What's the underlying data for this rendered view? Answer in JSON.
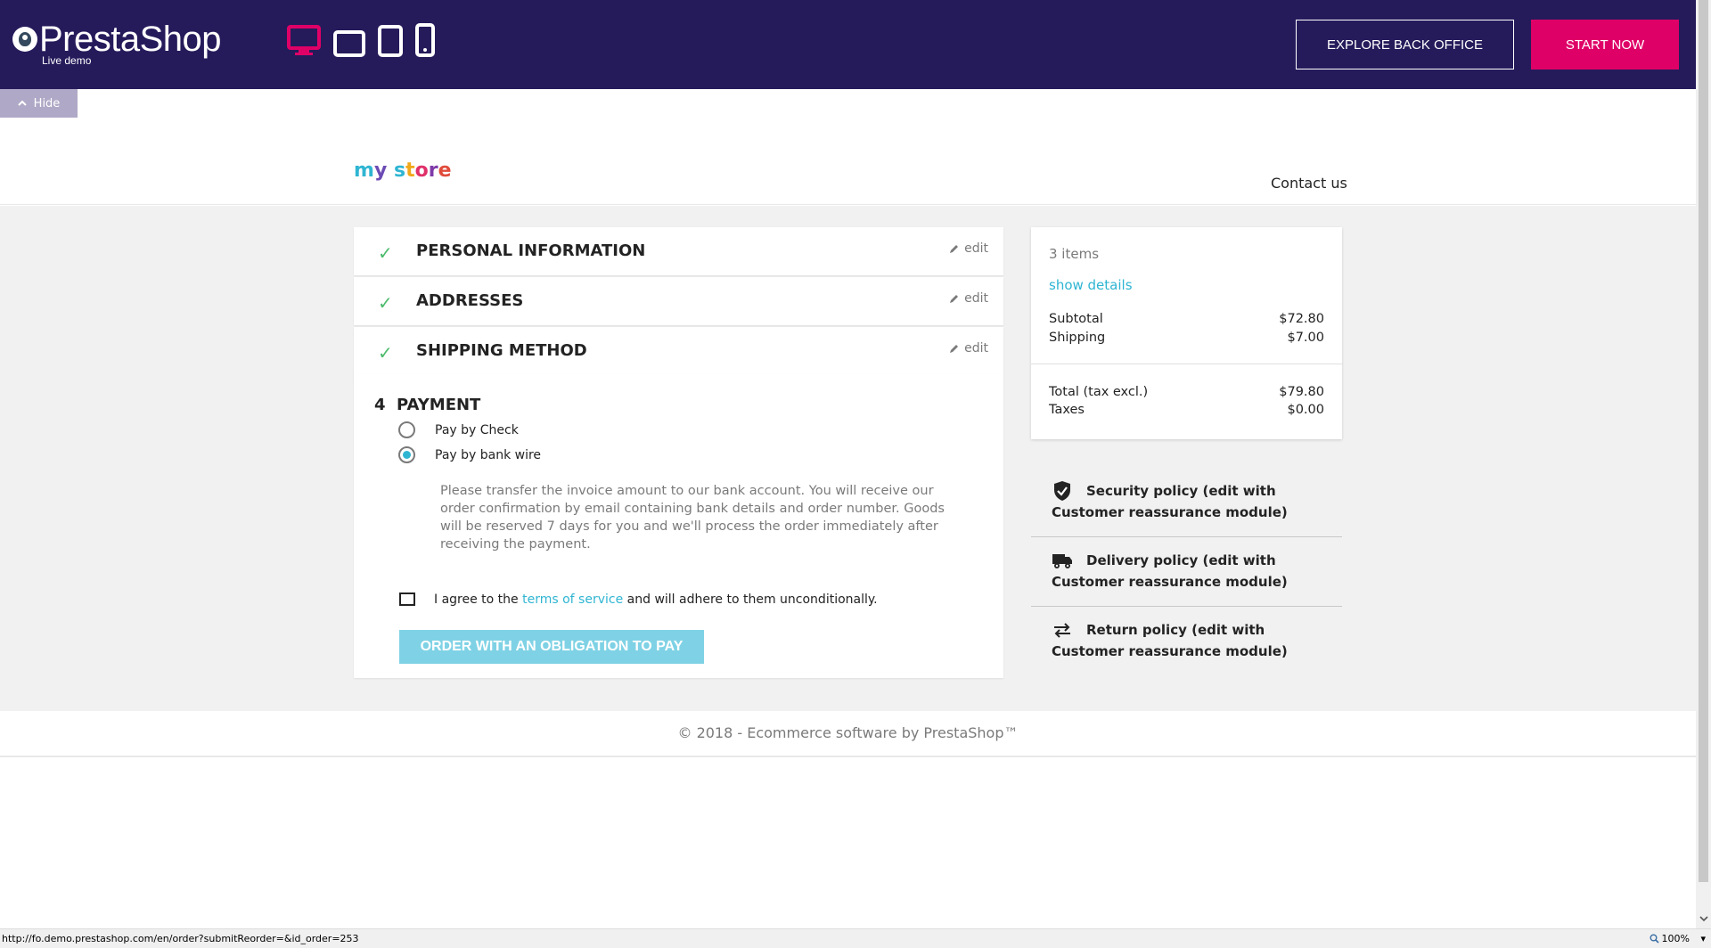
{
  "demo_bar": {
    "logo_text": "PrestaShop",
    "logo_sub": "Live demo",
    "devices": [
      "desktop-icon",
      "tablet-landscape-icon",
      "tablet-portrait-icon",
      "mobile-icon"
    ],
    "explore_label": "EXPLORE BACK OFFICE",
    "start_label": "START NOW",
    "hide_label": "Hide",
    "colors": {
      "bar": "#251b5b",
      "accent": "#df0067"
    }
  },
  "store": {
    "logo": "my store",
    "contact_label": "Contact us"
  },
  "checkout": {
    "steps": [
      {
        "title": "PERSONAL INFORMATION",
        "edit": "edit"
      },
      {
        "title": "ADDRESSES",
        "edit": "edit"
      },
      {
        "title": "SHIPPING METHOD",
        "edit": "edit"
      }
    ],
    "payment": {
      "number": "4",
      "title": "PAYMENT",
      "options": [
        {
          "label": "Pay by Check",
          "selected": false
        },
        {
          "label": "Pay by bank wire",
          "selected": true
        }
      ],
      "description": "Please transfer the invoice amount to our bank account. You will receive our order confirmation by email containing bank details and order number. Goods will be reserved 7 days for you and we'll process the order immediately after receiving the payment.",
      "terms_prefix": "I agree to the",
      "terms_link": "terms of service",
      "terms_suffix": "and will adhere to them unconditionally.",
      "order_button": "ORDER WITH AN OBLIGATION TO PAY"
    }
  },
  "summary": {
    "items_count": "3 items",
    "show_details": "show details",
    "subtotal_label": "Subtotal",
    "subtotal_value": "$72.80",
    "shipping_label": "Shipping",
    "shipping_value": "$7.00",
    "total_label": "Total (tax excl.)",
    "total_value": "$79.80",
    "taxes_label": "Taxes",
    "taxes_value": "$0.00"
  },
  "reassurance": [
    {
      "icon": "shield-icon",
      "text": "Security policy (edit with Customer reassurance module)"
    },
    {
      "icon": "truck-icon",
      "text": "Delivery policy (edit with Customer reassurance module)"
    },
    {
      "icon": "return-arrows-icon",
      "text": "Return policy (edit with Customer reassurance module)"
    }
  ],
  "footer": {
    "copyright": "© 2018 - Ecommerce software by PrestaShop™"
  },
  "status_bar": {
    "url": "http://fo.demo.prestashop.com/en/order?submitReorder=&id_order=253",
    "zoom": "100%"
  }
}
